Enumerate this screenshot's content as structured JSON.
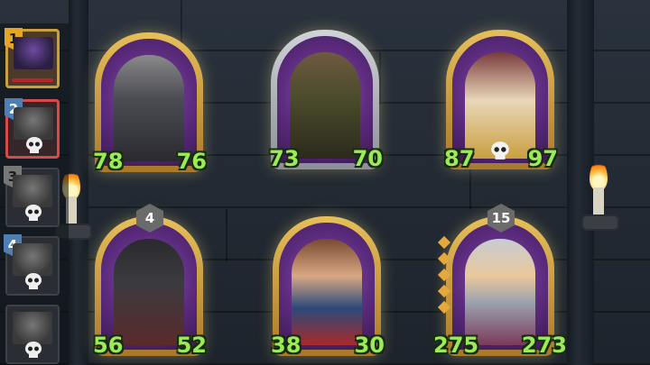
{
  "turn_order": [
    {
      "number": "1",
      "state": "first",
      "tag_color": "gold",
      "icon": "purple-bat-portrait-icon"
    },
    {
      "number": "2",
      "state": "active",
      "tag_color": "blue",
      "icon": "skull-icon"
    },
    {
      "number": "3",
      "state": "normal",
      "tag_color": "grey",
      "icon": "skull-icon"
    },
    {
      "number": "4",
      "state": "normal",
      "tag_color": "blue",
      "icon": "skull-icon"
    },
    {
      "number": "",
      "state": "normal",
      "tag_color": "none",
      "icon": "skull-icon"
    }
  ],
  "cards": [
    {
      "name": "crusader-knight",
      "attack": "78",
      "health": "76",
      "badge": "",
      "dead_marker": false,
      "diamonds": 0
    },
    {
      "name": "gunslinger",
      "attack": "73",
      "health": "70",
      "badge": "",
      "dead_marker": false,
      "diamonds": 0
    },
    {
      "name": "ogre-brute",
      "attack": "87",
      "health": "97",
      "badge": "",
      "dead_marker": true,
      "diamonds": 0
    },
    {
      "name": "shield-bearer",
      "attack": "56",
      "health": "52",
      "badge": "4",
      "dead_marker": false,
      "diamonds": 0
    },
    {
      "name": "caped-hero",
      "attack": "38",
      "health": "30",
      "badge": "",
      "dead_marker": false,
      "diamonds": 0
    },
    {
      "name": "valkyrie",
      "attack": "275",
      "health": "273",
      "badge": "15",
      "dead_marker": false,
      "diamonds": 5
    }
  ],
  "colors": {
    "stat_text": "#9bea57",
    "frame_gold": "#e6bf5a",
    "active_red": "#d84a4a"
  }
}
